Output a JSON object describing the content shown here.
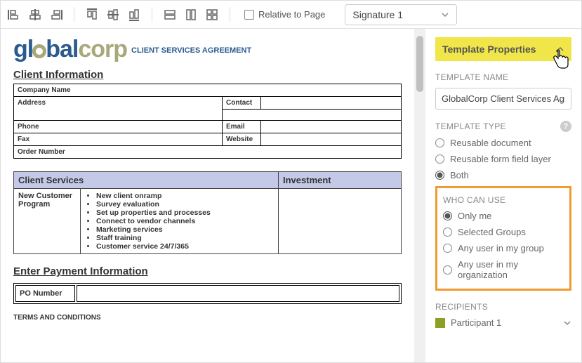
{
  "toolbar": {
    "relative_label": "Relative to Page",
    "select_value": "Signature 1"
  },
  "document": {
    "logo_part1": "gl",
    "logo_part2": "bal",
    "logo_corp": "corp",
    "logo_subtitle": "CLIENT SERVICES AGREEMENT",
    "sec_client_info": "Client Information",
    "fields": {
      "company": "Company Name",
      "address": "Address",
      "contact": "Contact",
      "phone": "Phone",
      "email": "Email",
      "fax": "Fax",
      "website": "Website",
      "order": "Order Number"
    },
    "svc_header1": "Client Services",
    "svc_header2": "Investment",
    "program_name": "New Customer Program",
    "services": [
      "New client onramp",
      "Survey evaluation",
      "Set up properties and processes",
      "Connect to vendor channels",
      "Marketing services",
      "Staff training",
      "Customer service 24/7/365"
    ],
    "sec_payment": "Enter Payment Information",
    "po_label": "PO Number",
    "terms_label": "TERMS AND CONDITIONS"
  },
  "panel": {
    "accordion_title": "Template Properties",
    "name_label": "TEMPLATE NAME",
    "name_value": "GlobalCorp Client Services Agreement",
    "type_label": "TEMPLATE TYPE",
    "type_options": [
      "Reusable document",
      "Reusable form field layer",
      "Both"
    ],
    "type_selected": 2,
    "who_label": "WHO CAN USE",
    "who_options": [
      "Only me",
      "Selected Groups",
      "Any user in my group",
      "Any user in my organization"
    ],
    "who_selected": 0,
    "recipients_label": "RECIPIENTS",
    "recipient1": "Participant 1"
  }
}
